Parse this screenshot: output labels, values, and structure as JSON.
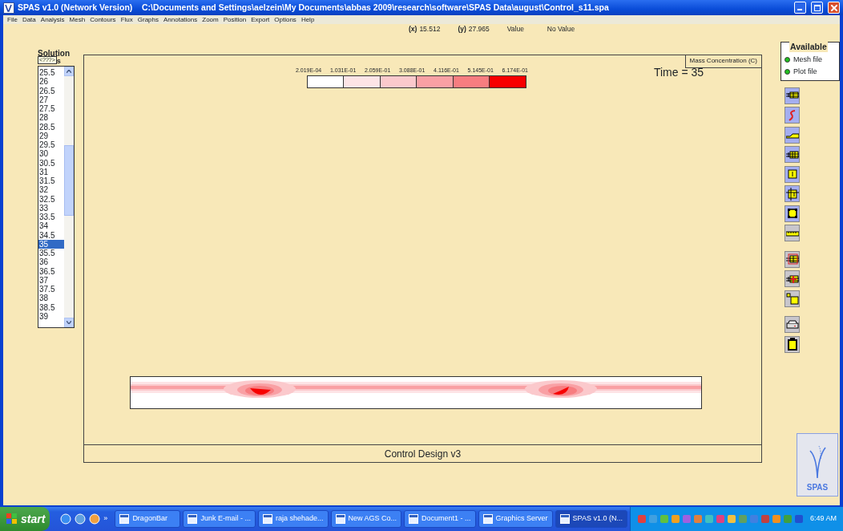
{
  "window": {
    "title": "SPAS v1.0 (Network Version)    C:\\Documents and Settings\\aelzein\\My Documents\\abbas 2009\\research\\software\\SPAS Data\\august\\Control_s11.spa"
  },
  "menu": [
    "File",
    "Data",
    "Analysis",
    "Mesh",
    "Contours",
    "Flux",
    "Graphs",
    "Annotations",
    "Zoom",
    "Position",
    "Export",
    "Options",
    "Help"
  ],
  "cursor_info": [
    {
      "kind": "coordinate",
      "label": "(x)",
      "value": "15.512"
    },
    {
      "kind": "coordinate",
      "label": "(y)",
      "value": "27.965"
    },
    {
      "kind": "field",
      "label": "Value",
      "value": "No Value"
    }
  ],
  "solution_list": {
    "heading": "Solution",
    "tooltip": "<???>",
    "heading_tail": "s",
    "items": [
      {
        "label": "25.5",
        "selected": false
      },
      {
        "label": "26",
        "selected": false
      },
      {
        "label": "26.5",
        "selected": false
      },
      {
        "label": "27",
        "selected": false
      },
      {
        "label": "27.5",
        "selected": false
      },
      {
        "label": "28",
        "selected": false
      },
      {
        "label": "28.5",
        "selected": false
      },
      {
        "label": "29",
        "selected": false
      },
      {
        "label": "29.5",
        "selected": false
      },
      {
        "label": "30",
        "selected": false
      },
      {
        "label": "30.5",
        "selected": false
      },
      {
        "label": "31",
        "selected": false
      },
      {
        "label": "31.5",
        "selected": false
      },
      {
        "label": "32",
        "selected": false
      },
      {
        "label": "32.5",
        "selected": false
      },
      {
        "label": "33",
        "selected": false
      },
      {
        "label": "33.5",
        "selected": false
      },
      {
        "label": "34",
        "selected": false
      },
      {
        "label": "34.5",
        "selected": false
      },
      {
        "label": "35",
        "selected": true
      },
      {
        "label": "35.5",
        "selected": false
      },
      {
        "label": "36",
        "selected": false
      },
      {
        "label": "36.5",
        "selected": false
      },
      {
        "label": "37",
        "selected": false
      },
      {
        "label": "37.5",
        "selected": false
      },
      {
        "label": "38",
        "selected": false
      },
      {
        "label": "38.5",
        "selected": false
      },
      {
        "label": "39",
        "selected": false
      }
    ]
  },
  "plot": {
    "variable": "Mass Concentration (C)",
    "legend_labels": [
      "2.019E-04",
      "1.031E-01",
      "2.059E-01",
      "3.088E-01",
      "4.116E-01",
      "5.145E-01",
      "6.174E-01"
    ],
    "swatches": [
      {
        "color": "#ffffff"
      },
      {
        "color": "#fde4e6"
      },
      {
        "color": "#fbc9cc"
      },
      {
        "color": "#f9a0a4"
      },
      {
        "color": "#f77d80"
      },
      {
        "color": "#f80000"
      }
    ],
    "time": "Time = 35",
    "caption": "Control Design v3"
  },
  "available": {
    "title": "Available",
    "items": [
      {
        "label": "Mesh file",
        "on": true
      },
      {
        "label": "Plot file",
        "on": true
      }
    ]
  },
  "tools": [
    {
      "kind": "mesh",
      "on": true
    },
    {
      "kind": "curve",
      "on": true
    },
    {
      "kind": "slope",
      "on": true
    },
    {
      "kind": "mesh-wide",
      "on": true
    },
    {
      "kind": "label",
      "on": true
    },
    {
      "kind": "node-label",
      "on": true
    },
    {
      "kind": "rectangle",
      "on": true
    },
    {
      "kind": "ruler",
      "on": false
    },
    {
      "kind": "mesh-zoom",
      "on": false
    },
    {
      "kind": "mesh-point",
      "on": false
    },
    {
      "kind": "resize",
      "on": false
    },
    {
      "kind": "printer",
      "on": false
    },
    {
      "kind": "clipboard",
      "on": false
    }
  ],
  "logo": {
    "text": "SPAS"
  },
  "taskbar": {
    "start": "start",
    "more": "»",
    "tasks": [
      {
        "label": "DragonBar",
        "selected": false
      },
      {
        "label": "Junk E-mail - ...",
        "selected": false
      },
      {
        "label": "raja shehade...",
        "selected": false
      },
      {
        "label": "New AGS Co...",
        "selected": false
      },
      {
        "label": "Document1 - ...",
        "selected": false
      },
      {
        "label": "Graphics Server",
        "selected": false
      },
      {
        "label": "SPAS v1.0 (N...",
        "selected": true
      }
    ],
    "clock": "6:49 AM"
  }
}
